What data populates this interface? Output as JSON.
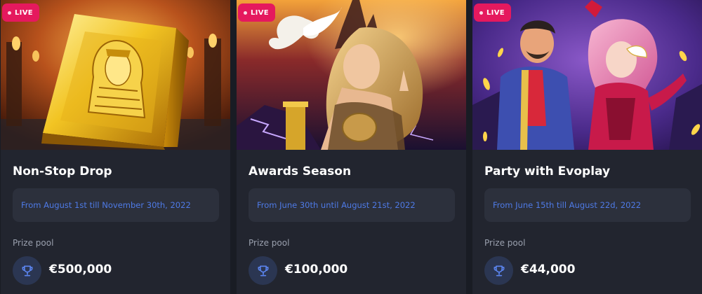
{
  "badge_label": "LIVE",
  "prize_pool_label": "Prize pool",
  "colors": {
    "page_bg": "#191c24",
    "card_bg": "#22252f",
    "dates_bg": "#2c303c",
    "dates_text": "#4e7ae6",
    "live_badge": "#e5195e",
    "trophy_circle": "#2b3652",
    "trophy_icon": "#5b84ee"
  },
  "tournaments": [
    {
      "title": "Non-Stop Drop",
      "dates": "From August 1st till November 30th, 2022",
      "prize": "€500,000",
      "art_icon": "golden-pharaoh-book-art"
    },
    {
      "title": "Awards Season",
      "dates": "From June 30th until August 21st, 2022",
      "prize": "€100,000",
      "art_icon": "goddess-with-dove-art"
    },
    {
      "title": "Party with Evoplay",
      "dates": "From June 15th till August 22d, 2022",
      "prize": "€44,000",
      "art_icon": "carnival-couple-art"
    }
  ]
}
